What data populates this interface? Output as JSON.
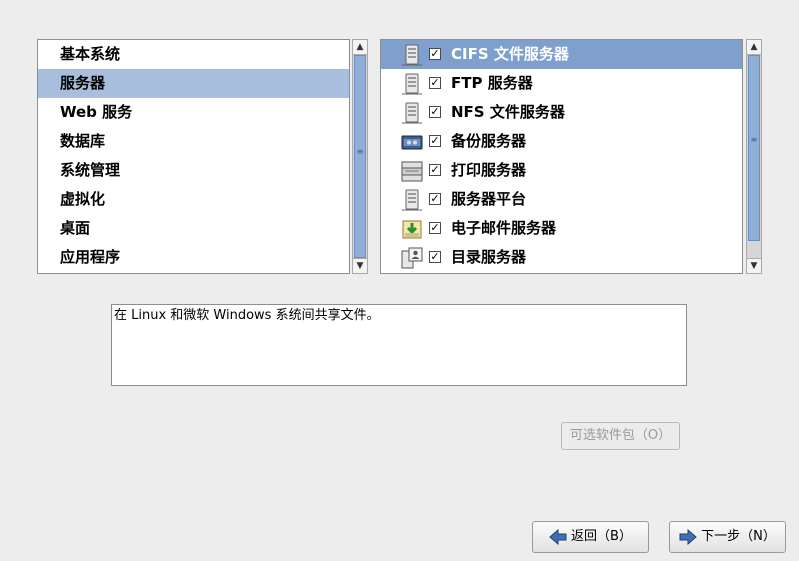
{
  "groups": {
    "items": [
      {
        "label": "基本系统"
      },
      {
        "label": "服务器"
      },
      {
        "label": "Web 服务"
      },
      {
        "label": "数据库"
      },
      {
        "label": "系统管理"
      },
      {
        "label": "虚拟化"
      },
      {
        "label": "桌面"
      },
      {
        "label": "应用程序"
      }
    ],
    "selected_index": 1
  },
  "packages": {
    "items": [
      {
        "label": "CIFS 文件服务器",
        "icon": "file-server-icon",
        "checked": true
      },
      {
        "label": "FTP 服务器",
        "icon": "ftp-server-icon",
        "checked": true
      },
      {
        "label": "NFS 文件服务器",
        "icon": "nfs-server-icon",
        "checked": true
      },
      {
        "label": "备份服务器",
        "icon": "backup-server-icon",
        "checked": true
      },
      {
        "label": "打印服务器",
        "icon": "printer-icon",
        "checked": true
      },
      {
        "label": "服务器平台",
        "icon": "server-platform-icon",
        "checked": true
      },
      {
        "label": "电子邮件服务器",
        "icon": "mail-server-icon",
        "checked": true
      },
      {
        "label": "目录服务器",
        "icon": "directory-server-icon",
        "checked": true
      }
    ],
    "selected_index": 0
  },
  "description": "在 Linux 和微软 Windows 系统间共享文件。",
  "buttons": {
    "optional": "可选软件包（O）",
    "back": "返回（B）",
    "next": "下一步（N）"
  },
  "colors": {
    "selected_group_bg": "#a7bfdd",
    "selected_pkg_bg": "#7f9fcd",
    "window_bg": "#ededed"
  }
}
